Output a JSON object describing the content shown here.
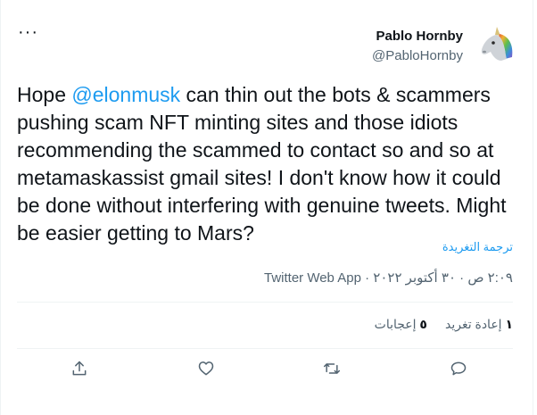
{
  "tweet": {
    "author_name": "Pablo Hornby",
    "author_handle": "@PabloHornby",
    "text_before": "Hope ",
    "mention": "@elonmusk",
    "text_after": " can thin out the bots & scammers pushing scam NFT minting sites and those idiots recommending the scammed to contact so and so at metamaskassist gmail sites! I don't know how it could be done without interfering with genuine tweets. Might be easier getting to Mars?",
    "translate_label": "ترجمة التغريدة",
    "timestamp": "٢:٠٩ ص · ٣٠ أكتوبر ٢٠٢٢",
    "separator": " · ",
    "source": "Twitter Web App"
  },
  "stats": {
    "retweets_count": "١",
    "retweets_label": "إعادة تغريد",
    "likes_count": "٥",
    "likes_label": "إعجابات"
  },
  "icons": {
    "more": "more-horizontal-icon",
    "share": "share-icon",
    "like": "heart-icon",
    "retweet": "retweet-icon",
    "reply": "reply-icon",
    "avatar": "unicorn-avatar"
  },
  "colors": {
    "accent": "#1d9bf0",
    "text": "#0f1419",
    "secondary": "#536471",
    "border": "#eff3f4"
  }
}
